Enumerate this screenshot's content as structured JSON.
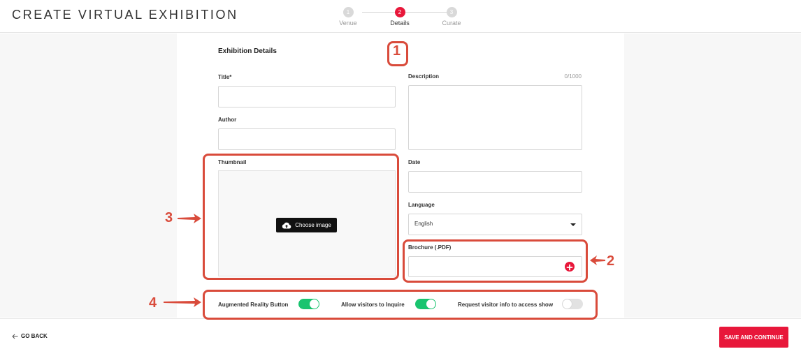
{
  "app": {
    "title": "CREATE VIRTUAL EXHIBITION"
  },
  "stepper": {
    "steps": [
      {
        "number": "1",
        "label": "Venue"
      },
      {
        "number": "2",
        "label": "Details"
      },
      {
        "number": "3",
        "label": "Curate"
      }
    ],
    "active_step": 2
  },
  "form": {
    "section_title": "Exhibition Details",
    "title_label": "Title*",
    "title_value": "",
    "author_label": "Author",
    "author_value": "",
    "thumbnail_label": "Thumbnail",
    "choose_image_label": "Choose image",
    "description_label": "Description",
    "description_counter": "0/1000",
    "description_value": "",
    "date_label": "Date",
    "date_value": "",
    "language_label": "Language",
    "language_value": "English",
    "brochure_label": "Brochure (.PDF)"
  },
  "toggles": [
    {
      "label": "Augmented Reality Button",
      "on": true
    },
    {
      "label": "Allow visitors to Inquire",
      "on": true
    },
    {
      "label": "Request visitor info to access show",
      "on": false
    }
  ],
  "footer": {
    "back_label": "GO BACK",
    "save_label": "SAVE AND CONTINUE"
  },
  "annotations": [
    "1",
    "2",
    "3",
    "4"
  ],
  "colors": {
    "accent": "#e8173a",
    "toggle_on": "#19c46f",
    "annotation": "#d94b3b"
  }
}
